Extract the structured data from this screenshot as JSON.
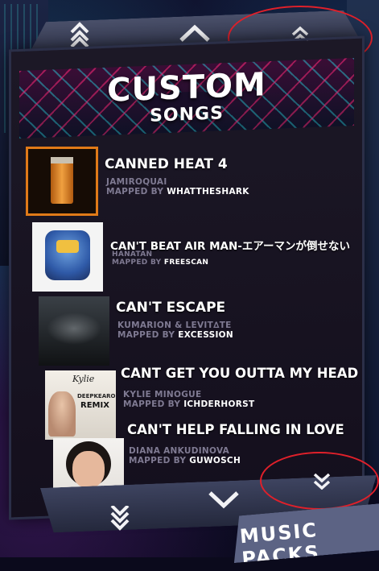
{
  "header": {
    "title_line1": "CUSTOM",
    "title_line2": "SONGS"
  },
  "nav": {
    "page_up_fast": "⇈",
    "page_up": "︿",
    "scroll_up": "⌃⌃",
    "page_down": "﹀",
    "page_down_fast": "⇊",
    "scroll_down": "⌄⌄"
  },
  "songs": [
    {
      "title": "CANNED HEAT 4",
      "artist": "JAMIROQUAI",
      "mapped_by_label": "MAPPED BY",
      "mapper": "WHATTHESHARK"
    },
    {
      "title": "CAN'T BEAT AIR MAN-エアーマンが倒せない",
      "artist": "HANATAN",
      "mapped_by_label": "MAPPED BY",
      "mapper": "FREESCAN"
    },
    {
      "title": "CAN'T ESCAPE",
      "artist": "KUMARION & LEVIT∆TE",
      "mapped_by_label": "MAPPED BY",
      "mapper": "EXCESSION"
    },
    {
      "title": "CANT GET YOU OUTTA MY HEAD",
      "artist": "KYLIE MINOGUE",
      "mapped_by_label": "MAPPED BY",
      "mapper": "ICHDERHORST"
    },
    {
      "title": "CAN'T HELP FALLING IN LOVE",
      "artist": "DIANA ANKUDINOVA",
      "mapped_by_label": "MAPPED BY",
      "mapper": "GUWOSCH"
    }
  ],
  "covers": {
    "cover4_text1": "Kylie",
    "cover4_text2": "DEEPKEARO",
    "cover4_text3": "REMIX"
  },
  "music_packs_label": "MUSIC PACKS",
  "colors": {
    "callout": "#e0202a",
    "meta": "#7f7a92",
    "panel": "#1c1826"
  }
}
